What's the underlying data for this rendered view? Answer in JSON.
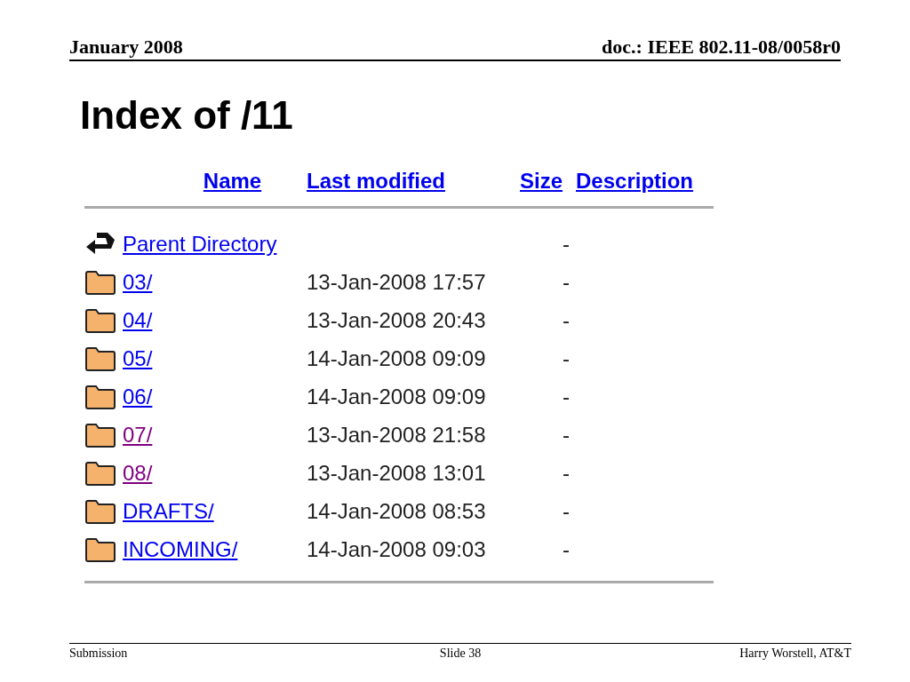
{
  "slide_header": {
    "date": "January 2008",
    "doc": "doc.: IEEE 802.11-08/0058r0"
  },
  "page": {
    "title": "Index of /11",
    "columns": [
      "Name",
      "Last modified",
      "Size",
      "Description"
    ],
    "rows": [
      {
        "kind": "parent",
        "name": "Parent Directory",
        "modified": "",
        "size": "-",
        "visited": false
      },
      {
        "kind": "folder",
        "name": "03/",
        "modified": "13-Jan-2008 17:57",
        "size": "-",
        "visited": false
      },
      {
        "kind": "folder",
        "name": "04/",
        "modified": "13-Jan-2008 20:43",
        "size": "-",
        "visited": false
      },
      {
        "kind": "folder",
        "name": "05/",
        "modified": "14-Jan-2008 09:09",
        "size": "-",
        "visited": false
      },
      {
        "kind": "folder",
        "name": "06/",
        "modified": "14-Jan-2008 09:09",
        "size": "-",
        "visited": false
      },
      {
        "kind": "folder",
        "name": "07/",
        "modified": "13-Jan-2008 21:58",
        "size": "-",
        "visited": true
      },
      {
        "kind": "folder",
        "name": "08/",
        "modified": "13-Jan-2008 13:01",
        "size": "-",
        "visited": true
      },
      {
        "kind": "folder",
        "name": "DRAFTS/",
        "modified": "14-Jan-2008 08:53",
        "size": "-",
        "visited": false
      },
      {
        "kind": "folder",
        "name": "INCOMING/",
        "modified": "14-Jan-2008 09:03",
        "size": "-",
        "visited": false
      }
    ]
  },
  "slide_footer": {
    "left": "Submission",
    "center": "Slide 38",
    "right": "Harry Worstell, AT&T"
  }
}
